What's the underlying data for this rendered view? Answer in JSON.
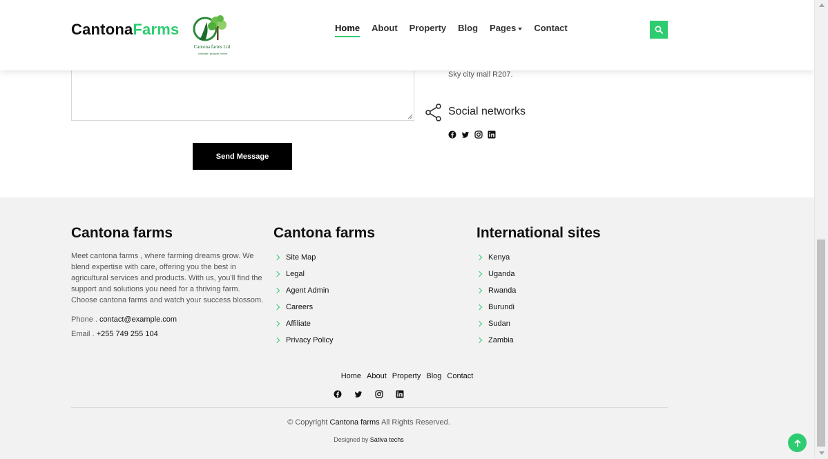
{
  "header": {
    "brand_primary": "Cantona",
    "brand_accent": "Farms",
    "logo_text": "Cantona farms Ltd",
    "logo_tagline": "cultivate, prosper, thrive",
    "nav": [
      {
        "label": "Home",
        "active": true
      },
      {
        "label": "About"
      },
      {
        "label": "Property"
      },
      {
        "label": "Blog"
      },
      {
        "label": "Pages",
        "dropdown": true
      },
      {
        "label": "Contact"
      }
    ],
    "search_icon": "search-icon"
  },
  "contact": {
    "message_value": "",
    "send_label": "Send Message",
    "address": "Sky city mall R207.",
    "social_title": "Social networks",
    "social_icons": [
      "facebook-icon",
      "twitter-icon",
      "instagram-icon",
      "linkedin-icon"
    ]
  },
  "footer": {
    "col1": {
      "title": "Cantona farms",
      "about": "Meet cantona farms , where farming dreams grow. We blend expertise with care, offering you the best in agricultural services and products. With us, you'll find the support and solutions you need for a thriving farm. Choose cantona farms and watch your success blossom.",
      "phone_label": "Phone .",
      "phone_value": "contact@example.com",
      "email_label": "Email .",
      "email_value": "+255 749 255 104"
    },
    "col2": {
      "title": "Cantona farms",
      "links": [
        "Site Map",
        "Legal",
        "Agent Admin",
        "Careers",
        "Affiliate",
        "Privacy Policy"
      ]
    },
    "col3": {
      "title": "International sites",
      "links": [
        "Kenya",
        "Uganda",
        "Rwanda",
        "Burundi",
        "Sudan",
        "Zambia"
      ]
    },
    "bottom_nav": [
      "Home",
      "About",
      "Property",
      "Blog",
      "Contact"
    ],
    "copyright_prefix": "© Copyright",
    "copyright_name": "Cantona farms",
    "copyright_suffix": "All Rights Reserved.",
    "designed_prefix": "Designed by",
    "designed_name": "Sativa techs"
  },
  "colors": {
    "accent": "#2ecc71",
    "footer_bg": "#f2f2f2",
    "button": "#000000"
  }
}
